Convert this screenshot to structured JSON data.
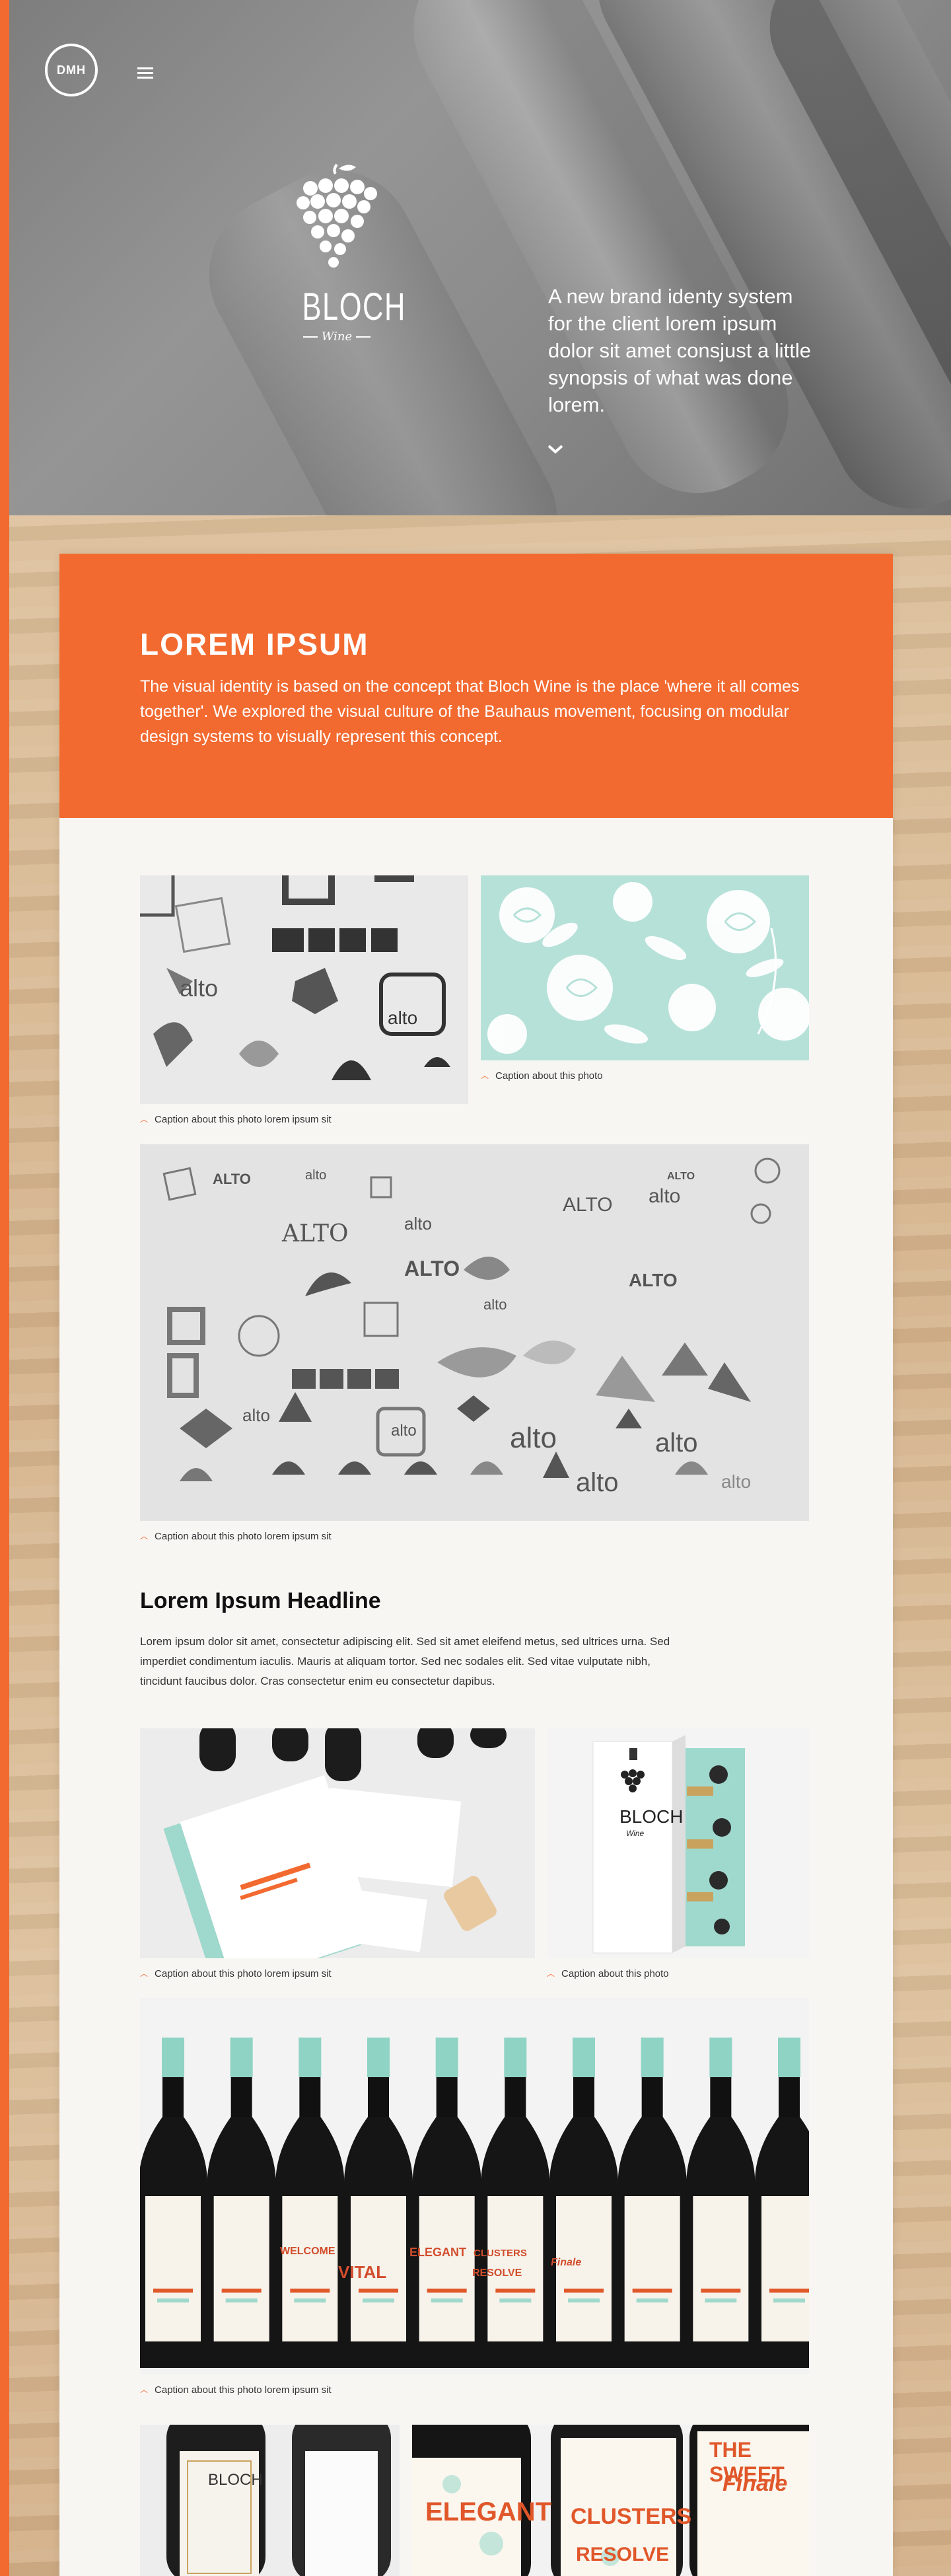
{
  "header": {
    "logo_text": "DMH",
    "menu_icon": "hamburger-icon"
  },
  "hero": {
    "brand_name": "BLOCH",
    "brand_sub": "Wine",
    "description": "A new brand identy system for the client lorem ipsum dolor sit amet consjust a little synopsis of what was done lorem.",
    "scroll_icon": "chevron-down-icon"
  },
  "intro": {
    "title": "LOREM IPSUM",
    "text": "The visual identity is based on the concept that Bloch Wine is the place 'where it all comes together'. We explored the visual culture of the Bauhaus movement, focusing on modular design systems to visually represent this concept."
  },
  "gallery": {
    "caption_logos": "Caption about this photo lorem ipsum sit",
    "caption_pattern": "Caption about this photo",
    "caption_collage": "Caption about this photo lorem ipsum sit",
    "caption_stationery": "Caption about this photo lorem ipsum sit",
    "caption_box": "Caption about this photo",
    "caption_bottles": "Caption about this photo lorem ipsum sit"
  },
  "article": {
    "headline": "Lorem Ipsum Headline",
    "body": "Lorem ipsum dolor sit amet, consectetur adipiscing elit. Sed sit amet eleifend metus, sed ultrices urna. Sed imperdiet condimentum iaculis. Mauris at aliquam tortor. Sed nec sodales elit. Sed vitae vulputate nibh, tincidunt faucibus dolor. Cras consectetur enim eu consectetur dapibus."
  },
  "image_text": {
    "logo_word": "alto",
    "logo_word_caps": "ALTO",
    "box_brand": "BLOCH",
    "box_sub": "Wine",
    "label_1": "WELCOME",
    "label_2": "ELEGANT",
    "label_3": "CLUSTERS",
    "label_4": "VITAL",
    "label_5": "RESOLVE",
    "label_6": "Finale",
    "label_7": "THE SWEET"
  },
  "colors": {
    "accent": "#f26a30",
    "mint": "#b6e1d8",
    "hero_gray": "#8a8a8a",
    "card_bg": "#f8f6f3"
  }
}
